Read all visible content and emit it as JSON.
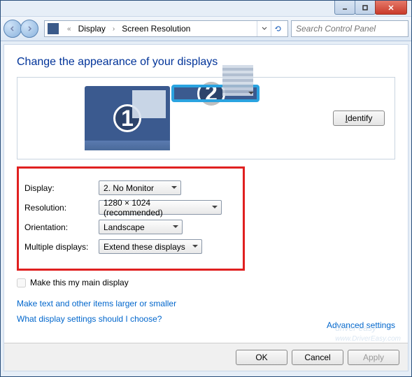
{
  "breadcrumb": {
    "item1": "Display",
    "item2": "Screen Resolution",
    "chev": "«"
  },
  "search": {
    "placeholder": "Search Control Panel"
  },
  "heading": "Change the appearance of your displays",
  "monitors": {
    "num1": "1",
    "num2": "2"
  },
  "identify_label": "Identify",
  "labels": {
    "display": "Display:",
    "resolution": "Resolution:",
    "orientation": "Orientation:",
    "multiple": "Multiple displays:"
  },
  "values": {
    "display": "2. No Monitor",
    "resolution": "1280 × 1024 (recommended)",
    "orientation": "Landscape",
    "multiple": "Extend these displays"
  },
  "checkbox_label": "Make this my main display",
  "advanced": "Advanced settings",
  "link1": "Make text and other items larger or smaller",
  "link2": "What display settings should I choose?",
  "buttons": {
    "ok": "OK",
    "cancel": "Cancel",
    "apply": "Apply"
  },
  "watermark": {
    "main": "driver easy",
    "sub": "www.DriverEasy.com"
  }
}
